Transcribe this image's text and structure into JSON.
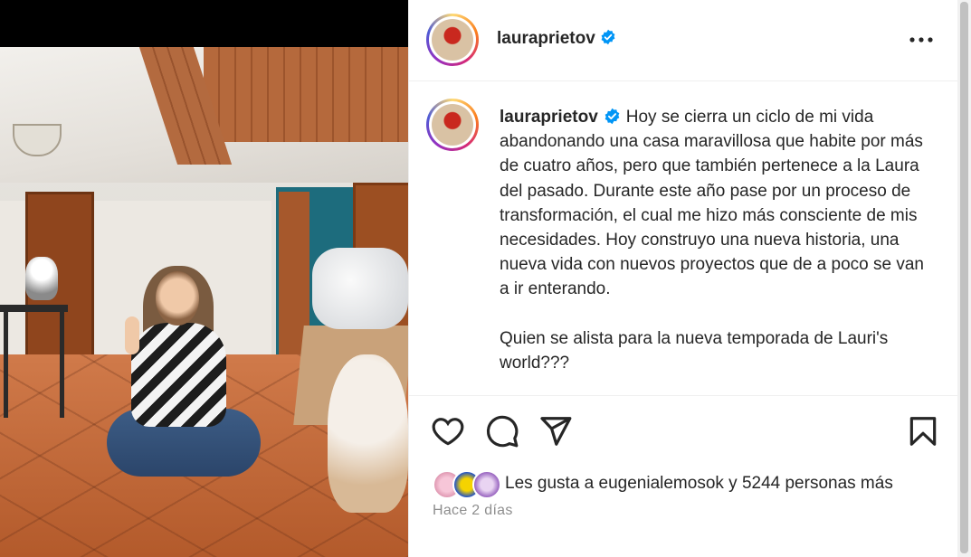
{
  "post": {
    "username": "lauraprietov",
    "verified": true,
    "caption": "Hoy se cierra un ciclo de mi vida abandonando una casa maravillosa que habite por más de cuatro años, pero que también pertenece a la Laura del pasado. Durante este año pase por un proceso de transformación, el cual me hizo más consciente de mis necesidades. Hoy construyo una nueva historia, una nueva vida con nuevos proyectos que de a poco se van a ir enterando.\n\nQuien se alista para la nueva temporada de Lauri's world???",
    "likes_text": "Les gusta a eugenialemosok y 5244 personas más",
    "time": "Hace 2 días"
  },
  "icons": {
    "more": "more-options-icon",
    "like": "heart-icon",
    "comment": "comment-icon",
    "share": "send-icon",
    "save": "bookmark-icon",
    "verified": "verified-badge-icon"
  },
  "colors": {
    "verified": "#0095f6",
    "text": "#262626",
    "muted": "#8e8e8e",
    "divider": "#efefef"
  }
}
